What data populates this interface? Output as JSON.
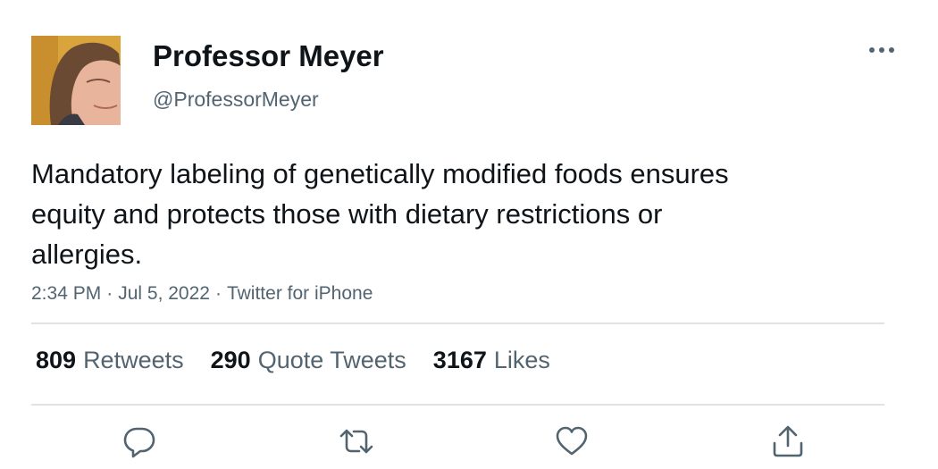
{
  "author": {
    "display_name": "Professor Meyer",
    "handle": "@ProfessorMeyer",
    "avatar_icon": "person-avatar"
  },
  "menu_icon": "more-horizontal-icon",
  "tweet": {
    "text": "Mandatory labeling of genetically modified foods ensures equity and protects those with dietary restrictions or allergies.",
    "time": "2:34 PM",
    "date": "Jul 5, 2022",
    "source": "Twitter for iPhone",
    "separator": "·"
  },
  "stats": {
    "retweets": {
      "count": "809",
      "label": "Retweets"
    },
    "quote_tweets": {
      "count": "290",
      "label": "Quote Tweets"
    },
    "likes": {
      "count": "3167",
      "label": "Likes"
    }
  },
  "actions": [
    {
      "name": "reply",
      "icon": "reply-icon"
    },
    {
      "name": "retweet",
      "icon": "retweet-icon"
    },
    {
      "name": "like",
      "icon": "heart-icon"
    },
    {
      "name": "share",
      "icon": "share-icon"
    }
  ],
  "colors": {
    "text_primary": "#0f1419",
    "text_secondary": "#536471",
    "divider": "#dfe3e6",
    "icon": "#536471"
  }
}
